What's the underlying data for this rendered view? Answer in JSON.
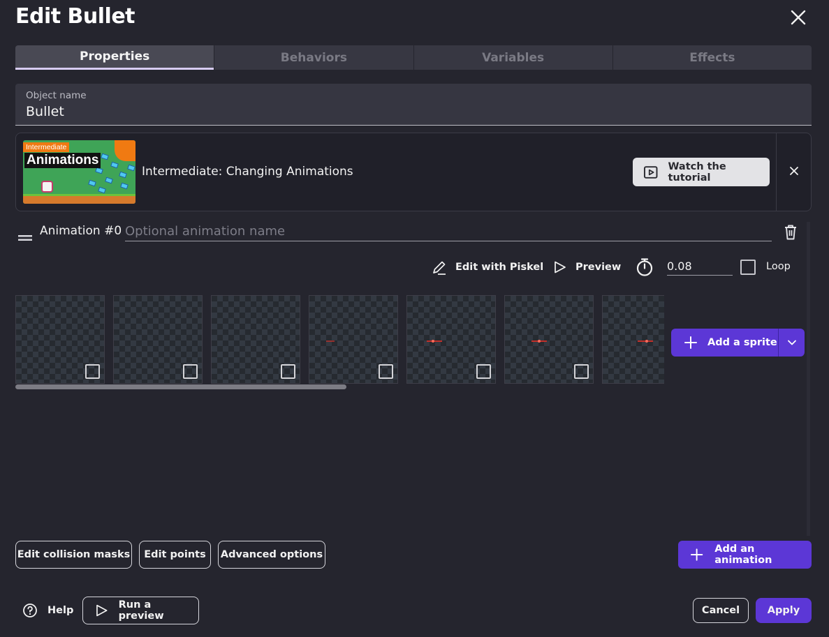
{
  "dialog": {
    "title": "Edit Bullet"
  },
  "tabs": [
    {
      "label": "Properties",
      "active": true
    },
    {
      "label": "Behaviors",
      "active": false
    },
    {
      "label": "Variables",
      "active": false
    },
    {
      "label": "Effects",
      "active": false
    }
  ],
  "object_name": {
    "label": "Object name",
    "value": "Bullet"
  },
  "tutorial": {
    "thumbnail_badge": "Intermediate",
    "thumbnail_title": "Animations",
    "title": "Intermediate: Changing Animations",
    "watch_label": "Watch the tutorial"
  },
  "animation": {
    "label": "Animation #0",
    "name_placeholder": "Optional animation name",
    "name_value": ""
  },
  "toolbar": {
    "edit_piskel": "Edit with Piskel",
    "preview": "Preview",
    "timing_value": "0.08",
    "loop_label": "Loop",
    "loop_checked": false
  },
  "frames": [
    {
      "selected": false,
      "bullet": "none"
    },
    {
      "selected": false,
      "bullet": "none"
    },
    {
      "selected": false,
      "bullet": "none"
    },
    {
      "selected": false,
      "bullet": "small"
    },
    {
      "selected": false,
      "bullet": "large"
    },
    {
      "selected": false,
      "bullet": "large"
    },
    {
      "selected": false,
      "bullet": "large"
    }
  ],
  "add_sprite_label": "Add a sprite",
  "bottom_actions": {
    "edit_collision_masks": "Edit collision masks",
    "edit_points": "Edit points",
    "advanced_options": "Advanced options",
    "add_animation": "Add an animation"
  },
  "footer": {
    "help": "Help",
    "run_preview": "Run a preview",
    "cancel": "Cancel",
    "apply": "Apply"
  },
  "colors": {
    "background": "#25252e",
    "accent": "#5c37d6",
    "tab_active_underline": "#d8cdf4"
  }
}
